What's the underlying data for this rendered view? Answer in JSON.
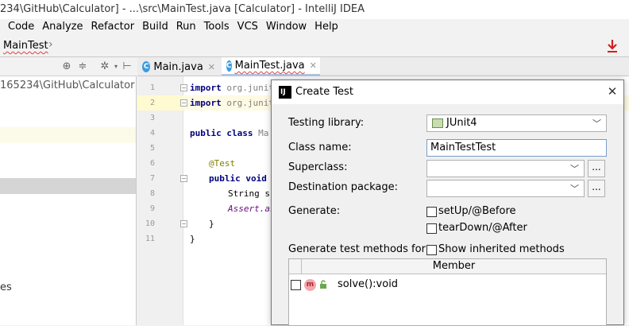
{
  "window": {
    "title": "234\\GitHub\\Calculator] - ...\\src\\MainTest.java [Calculator] - IntelliJ IDEA"
  },
  "menu": [
    "Code",
    "Analyze",
    "Refactor",
    "Build",
    "Run",
    "Tools",
    "VCS",
    "Window",
    "Help"
  ],
  "nav": {
    "crumb": "MainTest"
  },
  "project": {
    "path": "165234\\GitHub\\Calculator",
    "partial_item": "es"
  },
  "tabs": [
    {
      "label": "Main.java",
      "icon": "class-icon"
    },
    {
      "label": "MainTest.java",
      "icon": "class-icon",
      "active": true
    }
  ],
  "editor": {
    "line_numbers": [
      "1",
      "2",
      "3",
      "4",
      "5",
      "6",
      "7",
      "8",
      "9",
      "10",
      "11"
    ],
    "lines": {
      "l1_kw": "import",
      "l1_pkg": " org.junit",
      "l2_kw": "import",
      "l2_pkg": " org.junit",
      "l4_kw": "public class",
      "l4_rest": " Ma",
      "l6_an": "@Test",
      "l7_kw": "public void",
      "l8_rest": "String su",
      "l9_st": "Assert.as",
      "l10": "}",
      "l11": "}"
    }
  },
  "dialog": {
    "title": "Create Test",
    "testing_library_label": "Testing library:",
    "testing_library_value": "JUnit4",
    "class_name_label": "Class name:",
    "class_name_value": "MainTestTest",
    "superclass_label": "Superclass:",
    "superclass_value": "",
    "destination_label": "Destination package:",
    "destination_value": "",
    "ellipsis_label": "...",
    "generate_label": "Generate:",
    "setup_label": "setUp/@Before",
    "teardown_label": "tearDown/@After",
    "generate_methods_label": "Generate test methods for:",
    "show_inherited_label": "Show inherited methods",
    "table_header": "Member",
    "members": [
      {
        "name": "solve():void",
        "checked": false
      }
    ]
  },
  "colors": {
    "accent_blue": "#3d9be0",
    "download_red": "#d42020",
    "method_pink": "#f3a6ad"
  }
}
